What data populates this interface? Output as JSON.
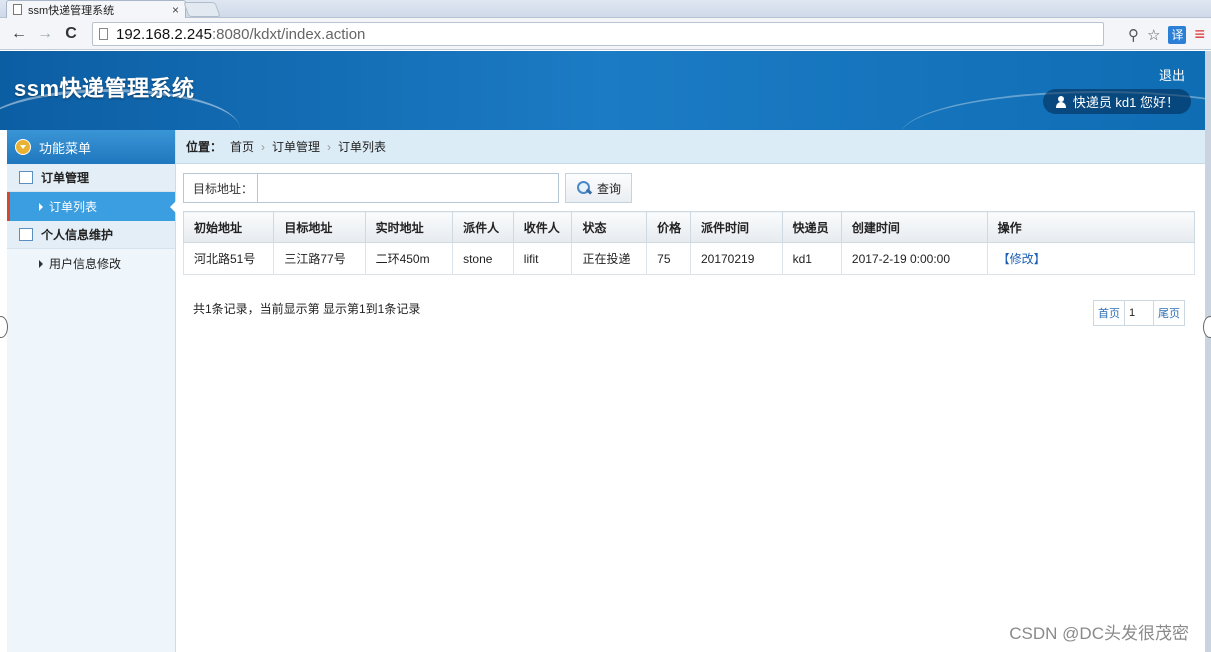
{
  "browser": {
    "tab_title": "ssm快递管理系统",
    "tab_close": "×",
    "url_host": "192.168.2.245",
    "url_path": ":8080/kdxt/index.action",
    "icons": [
      "back-icon",
      "forward-icon",
      "reload-icon",
      "key-icon",
      "star-icon",
      "translate-icon",
      "menu-icon"
    ],
    "translate_label": "译"
  },
  "header": {
    "title": "ssm快递管理系统",
    "logout": "退出",
    "welcome": "快递员 kd1 您好！"
  },
  "sidebar": {
    "title": "功能菜单",
    "groups": [
      {
        "label": "订单管理",
        "items": [
          {
            "label": "订单列表"
          }
        ]
      },
      {
        "label": "个人信息维护",
        "items": [
          {
            "label": "用户信息修改"
          }
        ]
      }
    ]
  },
  "breadcrumb": {
    "label": "位置：",
    "items": [
      "首页",
      "订单管理",
      "订单列表"
    ]
  },
  "search": {
    "label": "目标地址：",
    "value": "",
    "button": "查询"
  },
  "table": {
    "headers": [
      "初始地址",
      "目标地址",
      "实时地址",
      "派件人",
      "收件人",
      "状态",
      "价格",
      "派件时间",
      "快递员",
      "创建时间",
      "操作"
    ],
    "rows": [
      [
        "河北路51号",
        "三江路77号",
        "二环450m",
        "stone",
        "lifit",
        "正在投递",
        "75",
        "20170219",
        "kd1",
        "2017-2-19 0:00:00",
        "【修改】"
      ]
    ]
  },
  "pager": {
    "info": "共1条记录，当前显示第  显示第1到1条记录",
    "first": "首页",
    "page": "1",
    "last": "尾页"
  },
  "watermark": "CSDN @DC头发很茂密"
}
